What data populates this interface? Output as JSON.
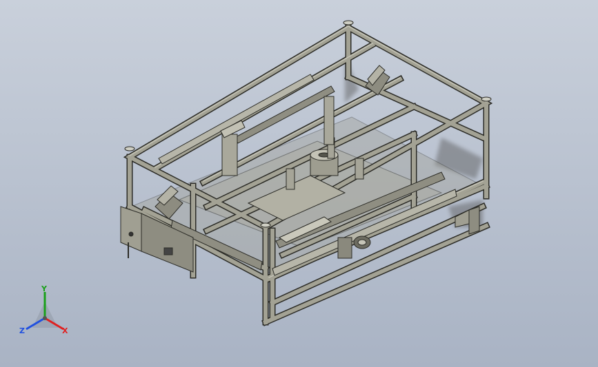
{
  "viewport": {
    "background_top": "#c9d0db",
    "background_bottom": "#a9b3c4"
  },
  "model": {
    "frame_color": "#a3a294",
    "frame_shadow": "#77766a",
    "edge_color": "#2b2b26"
  },
  "triad": {
    "x_label": "X",
    "y_label": "Y",
    "z_label": "Z",
    "x_color": "#e02020",
    "y_color": "#1aa01a",
    "z_color": "#2050e0"
  }
}
